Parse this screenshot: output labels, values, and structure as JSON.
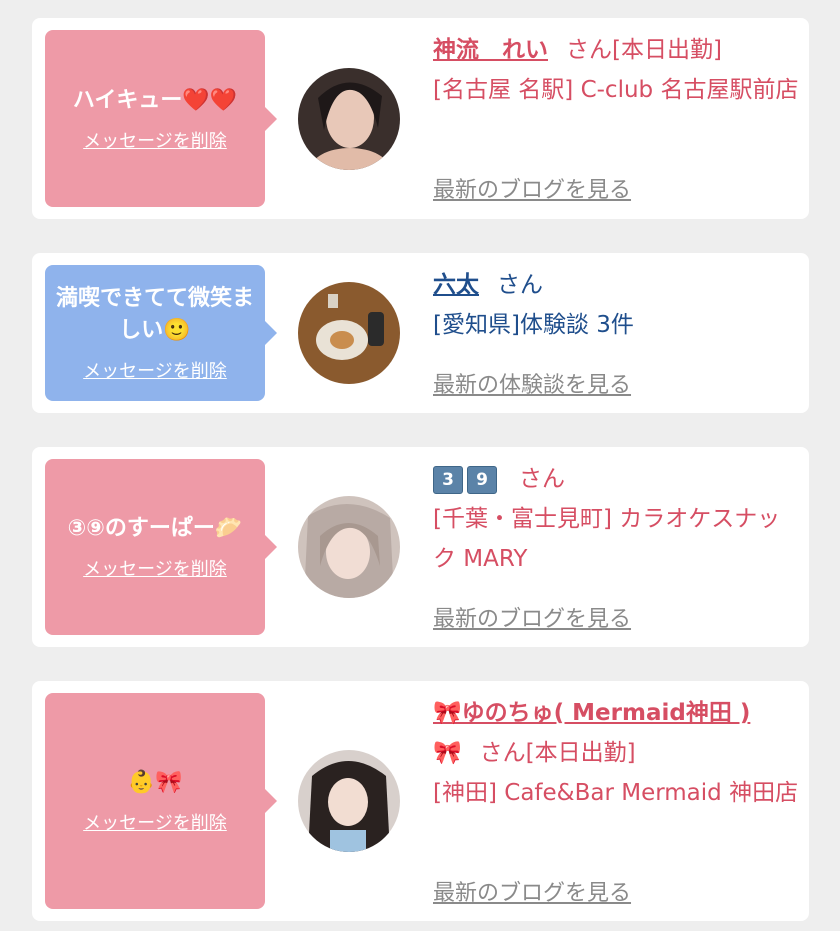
{
  "colors": {
    "pink_bubble": "#ee9aa7",
    "blue_bubble": "#8fb3ec",
    "red_text": "#d64e63",
    "navy_text": "#1f4e8c",
    "gray_link": "#8a8a8a"
  },
  "delete_label": "メッセージを削除",
  "cards": [
    {
      "message": "ハイキュー❤️❤️",
      "name": "神流　れい",
      "san": "さん",
      "status": "[本日出勤]",
      "shop": "[名古屋 名駅] C-club 名古屋駅前店",
      "more": "最新のブログを見る"
    },
    {
      "message": "満喫できてて微笑ましい🙂",
      "name": "六太",
      "san": "さん",
      "status": "",
      "shop": "[愛知県]体験談 3件",
      "more": "最新の体験談を見る"
    },
    {
      "message": "③⑨のすーぱー🥟",
      "name_box1": "3",
      "name_box2": "9",
      "san": "さん",
      "status": "",
      "shop": "[千葉・富士見町] カラオケスナック MARY",
      "more": "最新のブログを見る"
    },
    {
      "message": "👶🎀",
      "name": "🎀ゆのちゅ( Mermaid神田 )",
      "name_line2": "🎀",
      "san": "さん",
      "status": "[本日出勤]",
      "shop": "[神田] Cafe&Bar Mermaid 神田店",
      "more": "最新のブログを見る"
    }
  ]
}
